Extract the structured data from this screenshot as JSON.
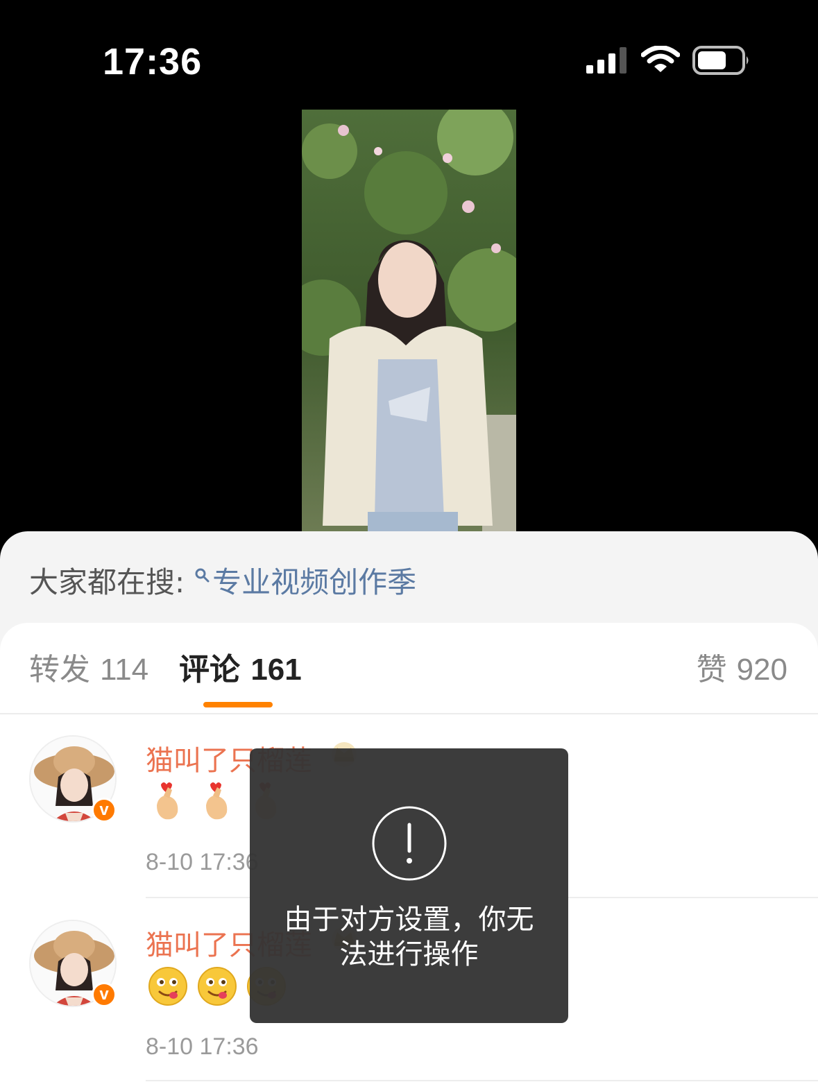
{
  "status_bar": {
    "time": "17:36",
    "icons": [
      "signal-icon",
      "wifi-icon",
      "battery-icon"
    ]
  },
  "media": {
    "icon": "photo"
  },
  "hot_search": {
    "label": "大家都在搜:",
    "query": "专业视频创作季",
    "icon": "search-icon"
  },
  "tabs": {
    "repost_label": "转发",
    "repost_count": "114",
    "comment_label": "评论",
    "comment_count": "161",
    "like_label": "赞",
    "like_count": "920",
    "active_color": "#ff8200"
  },
  "comments": [
    {
      "name": "猫叫了只榴莲",
      "badge": "crown-icon",
      "verified": "v",
      "emojis": [
        "finger-heart-emoji",
        "finger-heart-emoji",
        "finger-heart-emoji"
      ],
      "time": "8-10 17:36"
    },
    {
      "name": "猫叫了只榴莲",
      "badge": "crown-icon",
      "verified": "v",
      "emojis": [
        "yummy-face-emoji",
        "yummy-face-emoji",
        "yummy-face-emoji"
      ],
      "time": "8-10 17:36"
    }
  ],
  "toast": {
    "icon": "exclamation-icon",
    "message": "由于对方设置，你无法进行操作"
  },
  "colors": {
    "accent": "#ff8200",
    "username": "#eb7350",
    "link": "#5b7aa3"
  }
}
